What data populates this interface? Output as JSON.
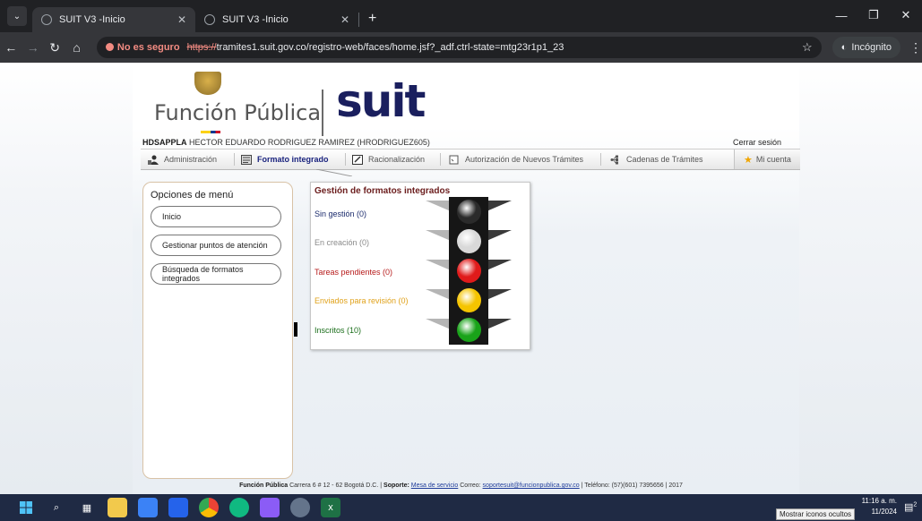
{
  "browser": {
    "tabs": [
      {
        "title": "SUIT V3 -Inicio",
        "active": true
      },
      {
        "title": "SUIT V3 -Inicio",
        "active": false
      }
    ],
    "new_tab": "+",
    "not_secure": "No es seguro",
    "url_protocol": "https://",
    "url_host": "tramites1.suit.gov.co",
    "url_path": "/registro-web/faces/home.jsf?_adf.ctrl-state=mtg23r1p1_23",
    "incognito_label": "Incógnito"
  },
  "brand": {
    "entity": "Función Pública",
    "product": "suit"
  },
  "user": {
    "code": "HDSAPPLA",
    "name": "HECTOR EDUARDO RODRIGUEZ RAMIREZ (HRODRIGUEZ605)",
    "logout": "Cerrar sesión"
  },
  "nav": {
    "tabs": [
      {
        "label": "Administración",
        "icon": "admin-icon"
      },
      {
        "label": "Formato integrado",
        "icon": "form-icon",
        "active": true
      },
      {
        "label": "Racionalización",
        "icon": "edit-icon"
      },
      {
        "label": "Autorización de Nuevos Trámites",
        "icon": "checkbox-icon"
      },
      {
        "label": "Cadenas de Trámites",
        "icon": "chain-icon"
      }
    ],
    "account": "Mi cuenta"
  },
  "sidebar": {
    "title": "Opciones de menú",
    "items": [
      {
        "label": "Inicio"
      },
      {
        "label": "Gestionar puntos de atención"
      },
      {
        "label": "Búsqueda de formatos integrados"
      }
    ]
  },
  "status_panel": {
    "title": "Gestión de formatos integrados",
    "rows": [
      {
        "label": "Sin gestión (0)",
        "color": "#1a2a6c",
        "lamp": "#2b2b2b"
      },
      {
        "label": "En creación (0)",
        "color": "#8a8a8a",
        "lamp": "#d9d9d9"
      },
      {
        "label": "Tareas pendientes (0)",
        "color": "#b71c1c",
        "lamp": "#e01b1b"
      },
      {
        "label": "Enviados para revisión (0)",
        "color": "#e0a21b",
        "lamp": "#f5c400"
      },
      {
        "label": "Inscritos (10)",
        "color": "#1b6e1b",
        "lamp": "#19a319"
      }
    ]
  },
  "footer": {
    "org": "Función Pública",
    "address": "Carrera 6 # 12 - 62 Bogotá D.C. |",
    "support_label": "Soporte:",
    "support_link": "Mesa de servicio",
    "mail_label": "Correo:",
    "mail": "soportesuit@funcionpublica.gov.co",
    "phone": "| Teléfono: (57)(601) 7395656 | 2017"
  },
  "taskbar": {
    "tooltip": "Mostrar iconos ocultos",
    "time": "11:16 a. m.",
    "date": "11/2024",
    "notifications": "2"
  }
}
